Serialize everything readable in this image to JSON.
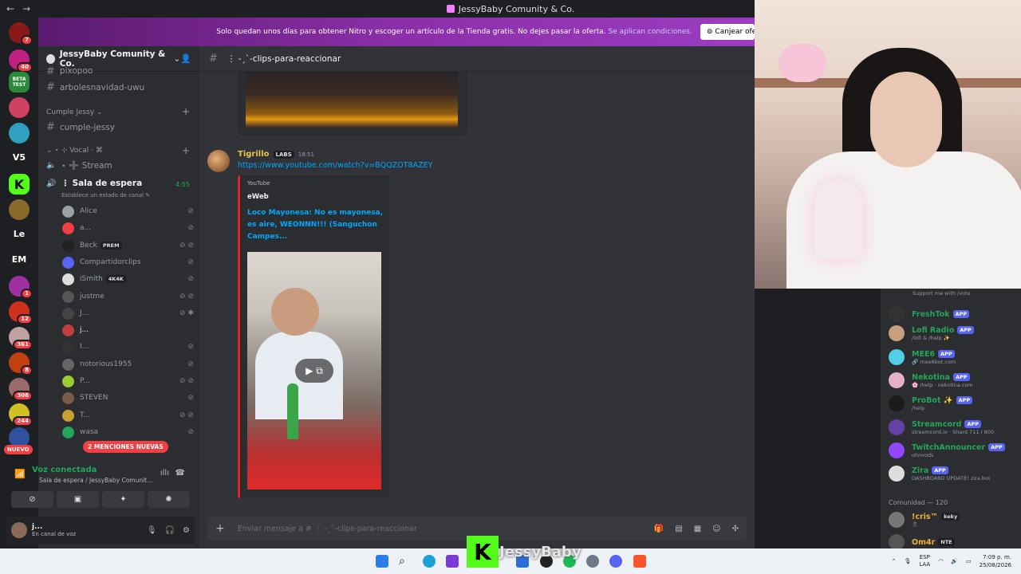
{
  "window": {
    "title": "JessyBaby Comunity & Co.",
    "back": "←",
    "forward": "→"
  },
  "banner": {
    "text": "Solo quedan unos días para obtener Nitro y escoger un artículo de la Tienda gratis. No dejes pasar la oferta.",
    "link": "Se aplican condiciones.",
    "button": "Canjear ofe"
  },
  "server_rail": {
    "badges": [
      "7",
      "40",
      "1",
      "12",
      "361",
      "8",
      "306",
      "244"
    ],
    "labels": [
      "BETA TEST",
      "V5",
      "Le",
      "EM"
    ],
    "nuevo": "NUEVO"
  },
  "sidebar": {
    "guild_name": "JessyBaby Comunity & Co.",
    "partial_channel": "pixopoo",
    "channels": [
      {
        "name": "arbolesnavidad-uwu"
      },
      {
        "name": "cumple-jessy"
      }
    ],
    "categories": [
      "Cumple Jessy",
      "⋆ ⊹ Vocal ⋅ ⌘"
    ],
    "voice_channels": [
      {
        "name": "⋆ ➕ Stream"
      },
      {
        "name": "⋮ Sala de espera",
        "timer": "4:55",
        "status": "Establece un estado de canal"
      }
    ],
    "members": [
      {
        "name": "Alice",
        "color": "#9aa0a6"
      },
      {
        "name": "a...",
        "color": "#f23f43"
      },
      {
        "name": "Beck",
        "tag": "PREM",
        "color": "#222"
      },
      {
        "name": "Compartidorclips",
        "color": "#5865f2"
      },
      {
        "name": "iSmith",
        "tag": "4K4K",
        "color": "#ddd"
      },
      {
        "name": "justme",
        "color": "#555"
      },
      {
        "name": "J...",
        "color": "#444"
      },
      {
        "name": "j...",
        "color": "#c04040"
      },
      {
        "name": "I...",
        "color": "#333"
      },
      {
        "name": "notorious1955",
        "color": "#666"
      },
      {
        "name": "P...",
        "color": "#9acd32"
      },
      {
        "name": "STEVEN",
        "color": "#7a5a4a"
      },
      {
        "name": "T...",
        "color": "#c8a030"
      },
      {
        "name": "wasa",
        "color": "#23a55a"
      }
    ],
    "mentions": "2 MENCIONES NUEVAS"
  },
  "voice": {
    "title": "Voz conectada",
    "subtitle": "Sala de espera / JessyBaby Comunit..."
  },
  "user": {
    "name": "j...",
    "status": "En canal de voz"
  },
  "chat": {
    "channel": "⋮ -ˏˋ-clips-para-reaccionar",
    "message": {
      "author": "Tigrillo",
      "badge": "LABS",
      "time": "18:51",
      "link": "https://www.youtube.com/watch?v=BQQZOT8AZEY"
    },
    "embed": {
      "provider": "YouTube",
      "author": "eWeb",
      "title": "Loco Mayonesa: No es mayonesa, es aire, WEONNN!!! (Sanguchon Campes..."
    },
    "composer_placeholder": "Enviar mensaje a # ⋮ -ˏˋ-clips-para-reaccionar"
  },
  "member_list": {
    "top_sub": "Support me with /vote",
    "bots": [
      {
        "name": "FreshTok",
        "sub": "",
        "color": "#333"
      },
      {
        "name": "Lofi Radio",
        "sub": "/lofi & /help ✨",
        "color": "#c8a080"
      },
      {
        "name": "MEE6",
        "sub": "🔗 mee6bot.com",
        "color": "#4fd0e8"
      },
      {
        "name": "Nekotina",
        "sub": "🌸 /help · nekotina.com",
        "color": "#e8b0c8"
      },
      {
        "name": "ProBot ✨",
        "sub": "/help",
        "color": "#1a1a1a"
      },
      {
        "name": "Streamcord",
        "sub": "streamcord.io · Shard 711 / 800",
        "color": "#6441a5"
      },
      {
        "name": "TwitchAnnouncer",
        "sub": "ohnvods",
        "color": "#9146ff"
      },
      {
        "name": "Zira",
        "sub": "DASHBOARD UPDATE! zira.bot",
        "color": "#ddd"
      }
    ],
    "app_tag": "APP",
    "community_header": "Comunidad — 120",
    "community": [
      {
        "name": "!cris™",
        "tag": "keky",
        "sub": "🎗",
        "color": "#777"
      },
      {
        "name": "Om4r",
        "tag": "NTE",
        "sub": "",
        "color": "#555"
      }
    ]
  },
  "overlay": {
    "logo": "K",
    "name": "JessyBaby"
  },
  "taskbar": {
    "lang1": "ESP",
    "lang2": "LAA",
    "time": "7:09 p. m.",
    "date": "25/08/2026"
  }
}
